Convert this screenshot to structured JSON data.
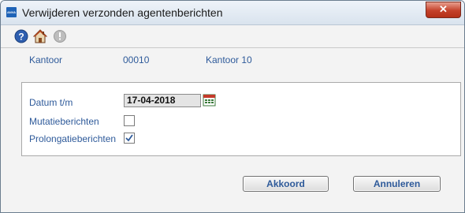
{
  "window": {
    "title": "Verwijderen verzonden agentenberichten",
    "close_symbol": "✕",
    "app_icon": "app-logo-icon"
  },
  "toolbar": {
    "icons": [
      "help-icon",
      "home-icon",
      "info-icon"
    ]
  },
  "info": {
    "label": "Kantoor",
    "code": "00010",
    "name": "Kantoor 10"
  },
  "form": {
    "date_label": "Datum t/m",
    "date_value": "17-04-2018",
    "mutatie_label": "Mutatieberichten",
    "mutatie_checked": false,
    "prolongatie_label": "Prolongatieberichten",
    "prolongatie_checked": true
  },
  "buttons": {
    "ok_label": "Akkoord",
    "cancel_label": "Annuleren"
  },
  "colors": {
    "label_blue": "#2e5a9a",
    "close_red": "#c4412a",
    "help_blue": "#2f5fb0"
  }
}
